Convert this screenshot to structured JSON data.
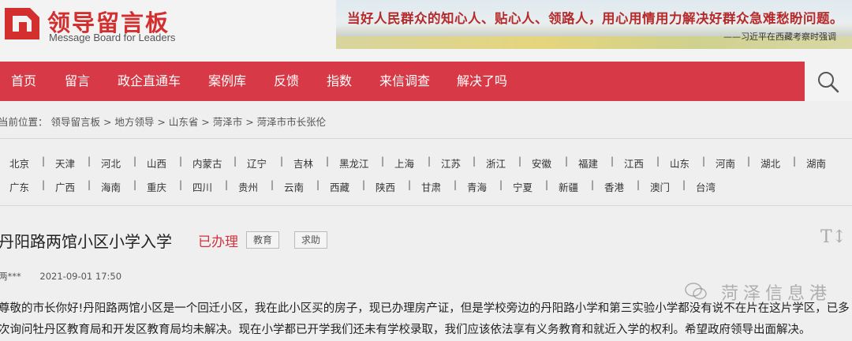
{
  "header": {
    "title": "领导留言板",
    "subtitle": "Message Board for Leaders",
    "banner_quote": "当好人民群众的知心人、贴心人、领路人，用心用情用力解决好群众急难愁盼问题。",
    "banner_attribution": "——习近平在西藏考察时强调"
  },
  "nav": {
    "items": [
      "首页",
      "留言",
      "政企直通车",
      "案例库",
      "反馈",
      "指数",
      "来信调查",
      "解决了吗"
    ],
    "accent": "#d73a46"
  },
  "breadcrumb": "当前位置： 领导留言板 > 地方领导 > 山东省 > 菏泽市 > 菏泽市市长张伦",
  "provinces": {
    "row1": [
      "北京",
      "天津",
      "河北",
      "山西",
      "内蒙古",
      "辽宁",
      "吉林",
      "黑龙江",
      "上海",
      "江苏",
      "浙江",
      "安徽",
      "福建",
      "江西",
      "山东",
      "河南",
      "湖北",
      "湖南"
    ],
    "row2": [
      "广东",
      "广西",
      "海南",
      "重庆",
      "四川",
      "贵州",
      "云南",
      "西藏",
      "陕西",
      "甘肃",
      "青海",
      "宁夏",
      "新疆",
      "香港",
      "澳门",
      "台湾"
    ],
    "separator": "|"
  },
  "article": {
    "title": "丹阳路两馆小区小学入学",
    "status": "已办理",
    "tags": [
      "教育",
      "求助"
    ],
    "author": "两***",
    "date": "2021-09-01 17:50",
    "line1": "尊敬的市长你好!丹阳路两馆小区是一个回迁小区，我在此小区买的房子，现已办理房产证，但是学校旁边的丹阳路小学和第三实验小学都没有说不在片在这片学区，已多",
    "line2": "次询问牡丹区教育局和开发区教育局均未解决。现在小学都已开学我们还未有学校录取，我们应该依法享有义务教育和就近入学的权利。希望政府领导出面解决。"
  },
  "watermark": "菏泽信息港",
  "icons": [
    "logo-mark",
    "search-icon",
    "font-size-icon",
    "wechat-icon"
  ]
}
